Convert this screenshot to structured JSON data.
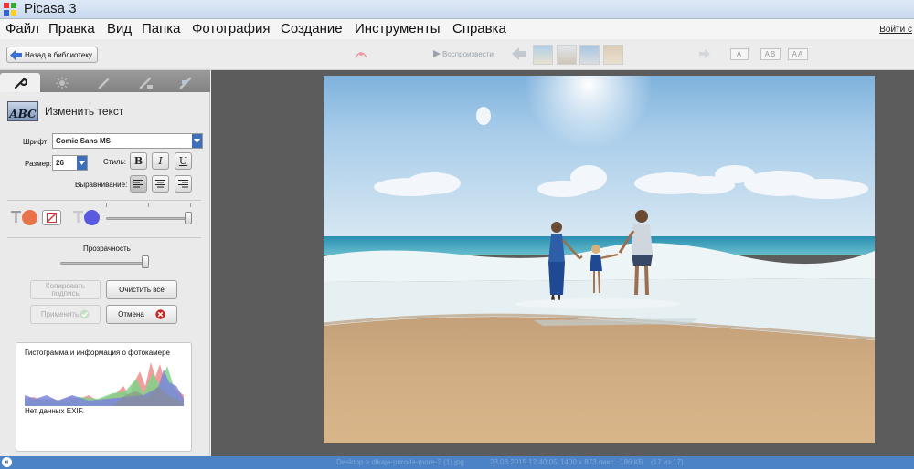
{
  "window": {
    "title": "Picasa 3"
  },
  "menu": {
    "items": [
      "Файл",
      "Правка",
      "Вид",
      "Папка",
      "Фотография",
      "Создание",
      "Инструменты",
      "Справка"
    ],
    "signin": "Войти с"
  },
  "toolbar": {
    "back_label": "Назад в библиотеку",
    "play_label": "Воспроизвести",
    "size_buttons": [
      "A",
      "AB",
      "AA"
    ]
  },
  "panel": {
    "section_title": "Изменить текст",
    "font_label": "Шрифт:",
    "font_value": "Comic Sans MS",
    "size_label": "Размер:",
    "size_value": "26",
    "style_label": "Стиль:",
    "style_buttons": [
      "B",
      "I",
      "U"
    ],
    "align_label": "Выравнивание:",
    "transparency_label": "Прозрачность",
    "copy_caption_label": "Копировать подпись",
    "clear_all_label": "Очистить все",
    "apply_label": "Применить",
    "cancel_label": "Отмена",
    "text_color": "#e8734a",
    "outline_color": "#5a5ae0",
    "outline_slider_level": 1.0,
    "transparency_level": 1.0
  },
  "histogram": {
    "title": "Гистограмма и информация о фотокамере",
    "exif": "Нет данных EXIF."
  },
  "status": {
    "path": "Desktop > dikaja-priroda-more-2 (1).jpg",
    "datetime": "23.03.2015 12:40:05",
    "dimensions": "1400 x 873 пикс.",
    "filesize": "186 КБ",
    "position": "(17 из 17)"
  },
  "colors": {
    "status_bar": "#4c83c6",
    "accent_blue": "#3f6fb9"
  }
}
